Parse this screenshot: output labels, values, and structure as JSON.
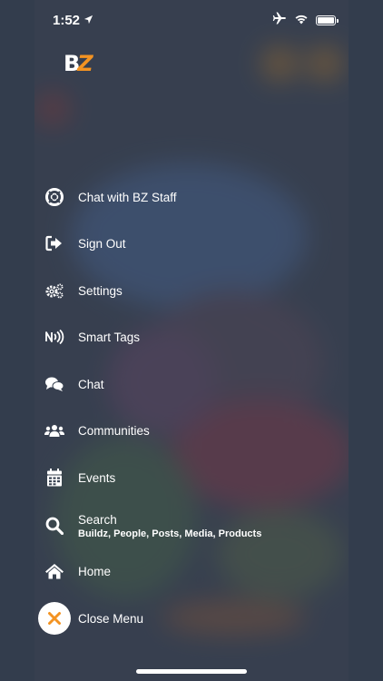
{
  "status_bar": {
    "time": "1:52",
    "location_icon": "location-arrow-icon",
    "airplane_icon": "airplane-icon",
    "wifi_icon": "wifi-icon",
    "battery_level": 1.0
  },
  "logo": {
    "text_b": "B",
    "text_z": "Z",
    "accent": "#f39322"
  },
  "menu": {
    "items": [
      {
        "label": "Chat with BZ Staff",
        "icon": "lifebuoy-icon"
      },
      {
        "label": "Sign Out",
        "icon": "sign-out-icon"
      },
      {
        "label": "Settings",
        "icon": "gears-icon"
      },
      {
        "label": "Smart Tags",
        "icon": "nfc-icon"
      },
      {
        "label": "Chat",
        "icon": "chat-bubbles-icon"
      },
      {
        "label": "Communities",
        "icon": "users-icon"
      },
      {
        "label": "Events",
        "icon": "calendar-icon"
      },
      {
        "label": "Search",
        "sublabel": "Buildz, People, Posts, Media, Products",
        "icon": "search-icon"
      },
      {
        "label": "Home",
        "icon": "home-icon"
      },
      {
        "label": "Close Menu",
        "icon": "close-icon"
      }
    ]
  },
  "colors": {
    "background": "#3a4453",
    "frame": "#333d4d",
    "close_accent": "#f39322"
  }
}
